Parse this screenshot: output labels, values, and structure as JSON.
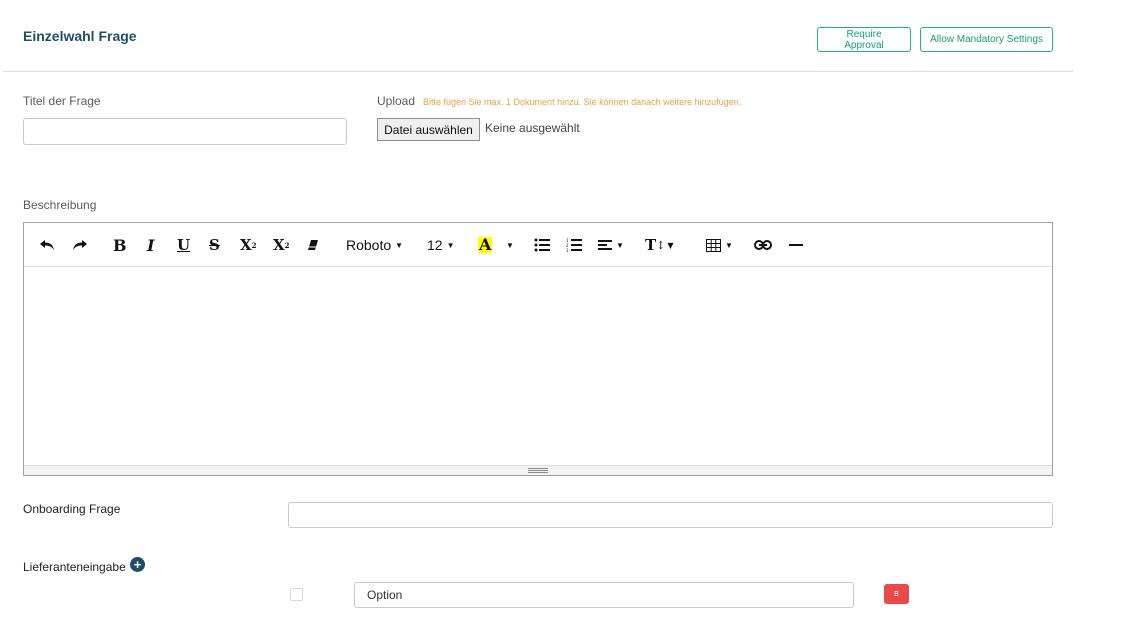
{
  "header": {
    "title": "Einzelwahl Frage",
    "require_approval_label": "Require Approval",
    "allow_mandatory_label": "Allow Mandatory Settings"
  },
  "form": {
    "question_title_label": "Titel der Frage",
    "question_title_value": "",
    "upload_label": "Upload",
    "upload_hint": "Bitte fügen Sie max. 1 Dokument hinzu. Sie können danach weitere hinzufügen.",
    "file_button_label": "Datei auswählen",
    "file_status": "Keine ausgewählt",
    "description_label": "Beschreibung",
    "onboarding_label": "Onboarding Frage",
    "onboarding_value": "",
    "supplier_input_label": "Lieferanteneingabe",
    "option_value": "Option",
    "delete_option_label": "B"
  },
  "editor": {
    "font_family": "Roboto",
    "font_size": "12",
    "highlight_color": "#ffff00",
    "icons": [
      "undo-icon",
      "redo-icon",
      "bold-icon",
      "italic-icon",
      "underline-icon",
      "strikethrough-icon",
      "superscript-icon",
      "subscript-icon",
      "eraser-icon",
      "font-color-icon",
      "unordered-list-icon",
      "ordered-list-icon",
      "align-icon",
      "line-height-icon",
      "table-icon",
      "link-icon",
      "horizontal-rule-icon"
    ]
  },
  "colors": {
    "title": "#1f4e6b",
    "accent": "#1cb68b",
    "hint": "#e8a33b",
    "danger": "#e84a4a"
  }
}
